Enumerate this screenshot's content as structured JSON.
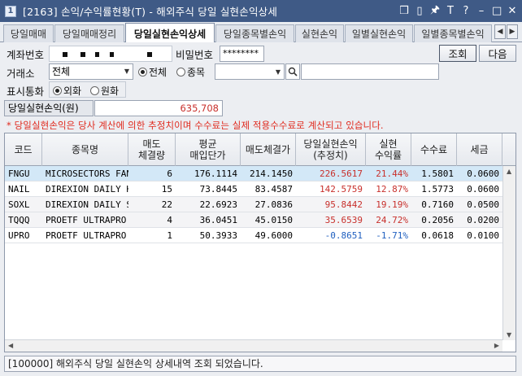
{
  "window": {
    "icon_label": "1",
    "title": "[2163] 손익/수익률현황(T) - 해외주식 당일 실현손익상세",
    "controls": [
      "❒",
      "▯",
      "🖈",
      "T",
      "?",
      "–",
      "□",
      "✕"
    ]
  },
  "tabs": [
    {
      "label": "당일매매",
      "active": false
    },
    {
      "label": "당일매매정리",
      "active": false
    },
    {
      "label": "당일실현손익상세",
      "active": true
    },
    {
      "label": "당일종목별손익",
      "active": false
    },
    {
      "label": "실현손익",
      "active": false
    },
    {
      "label": "일별실현손익",
      "active": false
    },
    {
      "label": "일별종목별손익",
      "active": false
    }
  ],
  "form": {
    "account_label": "계좌번호",
    "password_label": "비밀번호",
    "password_value": "********",
    "query_button": "조회",
    "next_button": "다음",
    "exchange_label": "거래소",
    "exchange_value": "전체",
    "radio_all": "전체",
    "radio_item": "종목",
    "currency_label": "표시통화",
    "radio_foreign": "외화",
    "radio_won": "원화"
  },
  "summary": {
    "label": "당일실현손익(원)",
    "value": "635,708",
    "notice": "* 당일실현손익은 당사 계산에 의한 추정치이며 수수료는 실제 적용수수료로 계산되고 있습니다."
  },
  "table": {
    "headers": [
      "코드",
      "종목명",
      "매도\n체결량",
      "평균\n매입단가",
      "매도체결가",
      "당일실현손익\n(추정치)",
      "실현\n수익률",
      "수수료",
      "세금"
    ],
    "rows": [
      {
        "code": "FNGU",
        "name": "MICROSECTORS FAN",
        "qty": "6",
        "avg_price": "176.1114",
        "sell_price": "214.1450",
        "pnl": "226.5617",
        "rate": "21.44%",
        "fee": "1.5801",
        "tax": "0.0600",
        "sign": "pos"
      },
      {
        "code": "NAIL",
        "name": "DIREXION DAILY H",
        "qty": "15",
        "avg_price": "73.8445",
        "sell_price": "83.4587",
        "pnl": "142.5759",
        "rate": "12.87%",
        "fee": "1.5773",
        "tax": "0.0600",
        "sign": "pos"
      },
      {
        "code": "SOXL",
        "name": "DIREXION DAILY S",
        "qty": "22",
        "avg_price": "22.6923",
        "sell_price": "27.0836",
        "pnl": "95.8442",
        "rate": "19.19%",
        "fee": "0.7160",
        "tax": "0.0500",
        "sign": "pos"
      },
      {
        "code": "TQQQ",
        "name": "PROETF ULTRAPRO",
        "qty": "4",
        "avg_price": "36.0451",
        "sell_price": "45.0150",
        "pnl": "35.6539",
        "rate": "24.72%",
        "fee": "0.2056",
        "tax": "0.0200",
        "sign": "pos"
      },
      {
        "code": "UPRO",
        "name": "PROETF ULTRAPRO",
        "qty": "1",
        "avg_price": "50.3933",
        "sell_price": "49.6000",
        "pnl": "-0.8651",
        "rate": "-1.71%",
        "fee": "0.0618",
        "tax": "0.0100",
        "sign": "neg"
      }
    ]
  },
  "status": {
    "message": "[100000] 해외주식 당일 실현손익 상세내역 조회 되었습니다."
  },
  "colors": {
    "titlebar": "#3f5a86",
    "positive": "#c8302c",
    "negative": "#2060c0",
    "selected_row": "#d3e8f7"
  }
}
